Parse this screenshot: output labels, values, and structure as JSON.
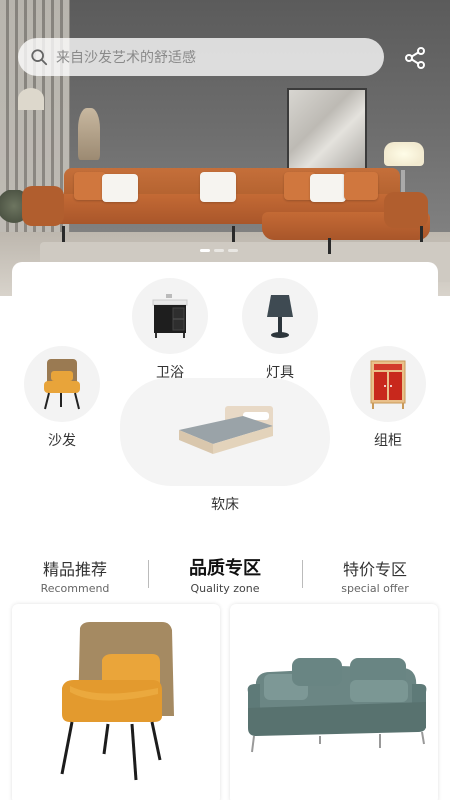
{
  "search": {
    "placeholder": "来自沙发艺术的舒适感"
  },
  "icons": {
    "search": "search-icon",
    "share": "share-icon"
  },
  "banner": {
    "slides": 3,
    "active_slide": 1
  },
  "categories": [
    {
      "label": "卫浴",
      "icon": "bathroom-cabinet-icon"
    },
    {
      "label": "灯具",
      "icon": "table-lamp-icon"
    },
    {
      "label": "沙发",
      "icon": "armchair-icon"
    },
    {
      "label": "组柜",
      "icon": "cabinet-icon"
    },
    {
      "label": "软床",
      "icon": "bed-icon"
    }
  ],
  "tabs": [
    {
      "title": "精品推荐",
      "subtitle": "Recommend"
    },
    {
      "title": "品质专区",
      "subtitle": "Quality zone",
      "active": true
    },
    {
      "title": "特价专区",
      "subtitle": "special offer"
    }
  ],
  "products": [
    {
      "image": "orange-armchair-image"
    },
    {
      "image": "green-sofa-image"
    }
  ],
  "colors": {
    "accent_sofa": "#b8602f",
    "chair_orange": "#e8a43a",
    "sofa_green": "#5e7a78"
  }
}
